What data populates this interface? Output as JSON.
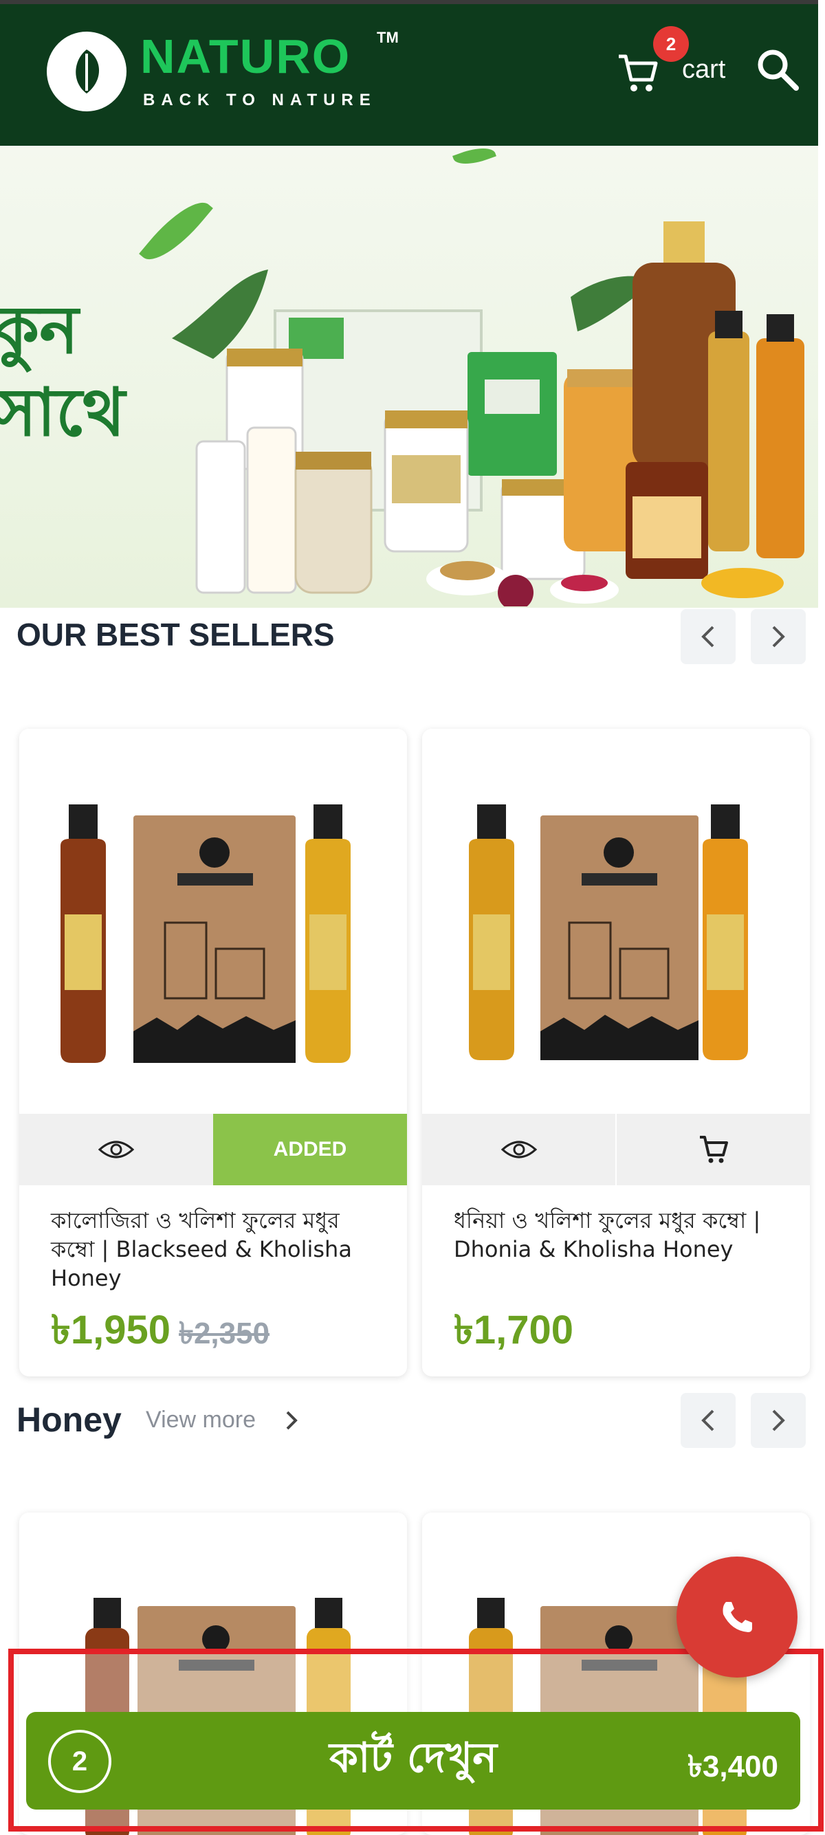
{
  "header": {
    "brand": "NATURO",
    "tm": "TM",
    "tagline": "BACK TO NATURE",
    "cart_badge": "2",
    "cart_label": "cart",
    "bg_color": "#0d3b1c",
    "brand_color": "#1ec65a"
  },
  "banner": {
    "text_line1": "কুন",
    "text_line2": "সাথে"
  },
  "best_sellers": {
    "title": "OUR BEST SELLERS",
    "products": [
      {
        "name": "কালোজিরা ও খলিশা ফুলের মধুর কম্বো | Blackseed & Kholisha Honey",
        "price": "৳1,950",
        "old_price": "৳2,350",
        "cart_action": "ADDED",
        "liquid_left": "#8a3a16",
        "liquid_right": "#e0a820"
      },
      {
        "name": "ধনিয়া ও খলিশা ফুলের মধুর কম্বো | Dhonia & Kholisha Honey",
        "price": "৳1,700",
        "old_price": "",
        "cart_action": "",
        "liquid_left": "#d89a1c",
        "liquid_right": "#e6961a"
      }
    ]
  },
  "honey": {
    "title": "Honey",
    "view_more": "View more"
  },
  "cart_bar": {
    "count": "2",
    "label": "কার্ট দেখুন",
    "total": "৳3,400",
    "color": "#5f9a12"
  },
  "accent": {
    "price_green": "#6aa121",
    "added_green": "#8bc34a",
    "call_red": "#d93b34"
  }
}
